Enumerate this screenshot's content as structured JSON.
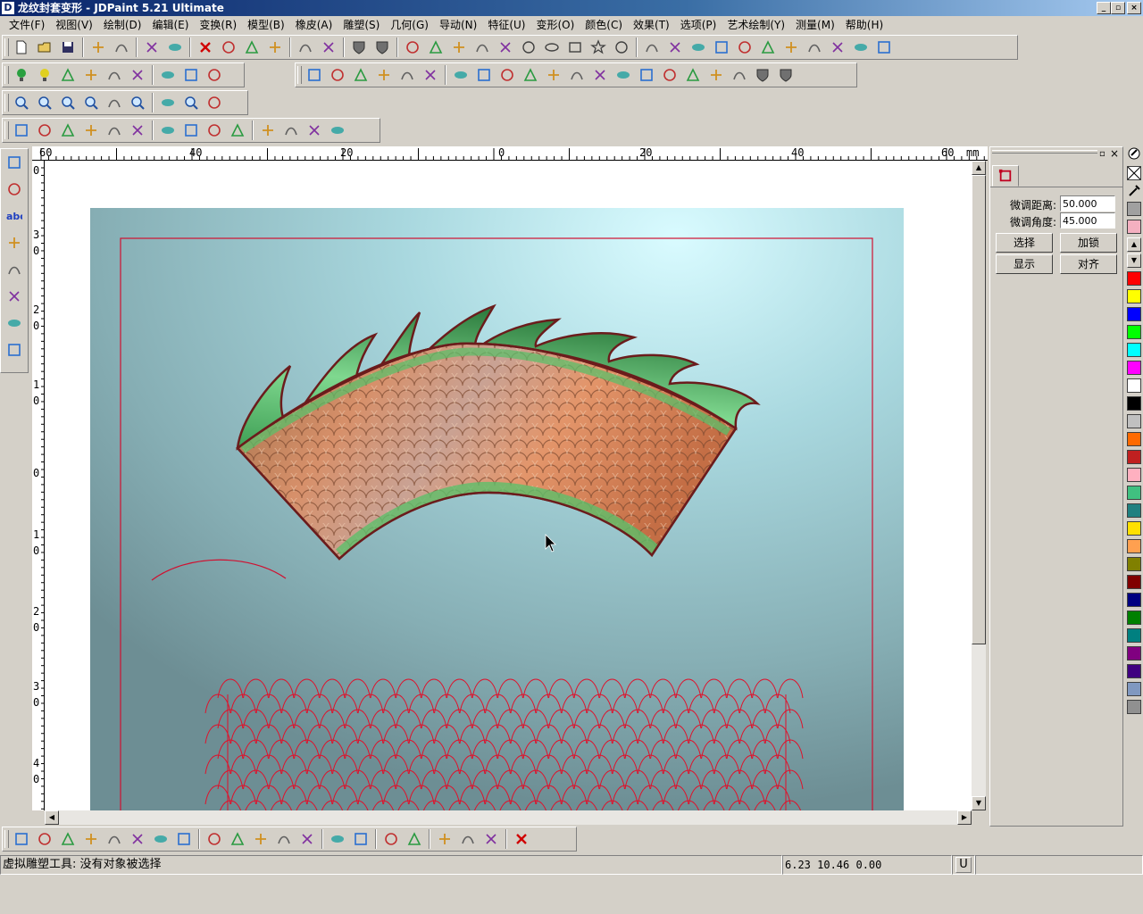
{
  "window": {
    "app_icon": "D",
    "title": "龙纹封套变形 - JDPaint 5.21 Ultimate",
    "controls": [
      "_",
      "▫",
      "×"
    ]
  },
  "menu": [
    "文件(F)",
    "视图(V)",
    "绘制(D)",
    "编辑(E)",
    "变换(R)",
    "模型(B)",
    "橡皮(A)",
    "雕塑(S)",
    "几何(G)",
    "导动(N)",
    "特征(U)",
    "变形(O)",
    "颜色(C)",
    "效果(T)",
    "选项(P)",
    "艺术绘制(Y)",
    "测量(M)",
    "帮助(H)"
  ],
  "ruler": {
    "unit": "mm",
    "top_labels": [
      "60",
      "40",
      "20",
      "0",
      "20",
      "40",
      "60"
    ],
    "left_labels": [
      "0",
      "3\n0",
      "2\n0",
      "1\n0",
      "0",
      "1\n0",
      "2\n0",
      "3\n0",
      "4\n0"
    ]
  },
  "panel": {
    "fine_distance_label": "微调距离:",
    "fine_distance_value": "50.000",
    "fine_angle_label": "微调角度:",
    "fine_angle_value": "45.000",
    "buttons": {
      "select": "选择",
      "lock": "加锁",
      "show": "显示",
      "align": "对齐"
    }
  },
  "palette": [
    "#ff0000",
    "#ffff00",
    "#0000ff",
    "#00ff00",
    "#00ffff",
    "#ff00ff",
    "#ffffff",
    "#000000",
    "#c0c0c0",
    "#ff6a00",
    "#c02020",
    "#ffb0c0",
    "#40c080",
    "#208080",
    "#ffe000",
    "#ffa050",
    "#808000",
    "#800000",
    "#000080",
    "#008000",
    "#008080",
    "#800080",
    "#400080",
    "#8098c0",
    "#909090"
  ],
  "status": {
    "message": "虚拟雕塑工具: 没有对象被选择",
    "coords": "6.23 10.46 0.00",
    "mode": "U"
  },
  "icons": {
    "toolbar_row1": [
      "new-file-icon",
      "open-folder-icon",
      "save-icon",
      "crosshair-icon",
      "select-box-icon",
      "undo-icon",
      "redo-icon",
      "delete-icon",
      "cut-icon",
      "copy-icon",
      "paste-icon",
      "cube-view-icon",
      "box-view-icon",
      "shield-icon",
      "shield-dark-icon",
      "point-icon",
      "line-icon",
      "arc-icon",
      "curve-icon",
      "polygon-icon",
      "circle-icon",
      "ellipse-icon",
      "rectangle-icon",
      "star-icon",
      "ring-icon",
      "trim-icon",
      "extend-icon",
      "fillet-icon",
      "chamfer-icon",
      "corner-icon",
      "offset-icon",
      "slot-icon",
      "frame-icon",
      "group-icon",
      "ungroup-icon",
      "combine-icon"
    ],
    "toolbar_row2": [
      "light-bulb-green-icon",
      "light-bulb-yellow-icon",
      "brush-icon",
      "nodes-icon",
      "diamond-icon",
      "arrow-icon",
      "book-icon",
      "grid-icon",
      "flask-icon",
      "plus-icon",
      "dimension-icon",
      "corner-arrow-icon",
      "box-corner-icon",
      "angle-icon",
      "rotate-icon",
      "align-left-icon",
      "align-center-icon",
      "distribute-icon",
      "align-top-icon",
      "align-middle-icon",
      "array-icon",
      "mesh-icon",
      "wave-icon",
      "spiral-icon",
      "matrix-icon",
      "cross-matrix-icon",
      "layers-icon",
      "stack-icon",
      "cup-icon",
      "cup-dark-icon"
    ],
    "toolbar_row3": [
      "zoom-window-icon",
      "zoom-in-icon",
      "zoom-out-icon",
      "zoom-pan-icon",
      "eye-icon",
      "zoom-fit-icon",
      "move-icon",
      "magnify-icon",
      "refresh-icon"
    ],
    "toolbar_row4": [
      "sculpt-blue-icon",
      "sculpt-wave-icon",
      "eraser-icon",
      "bowl-icon",
      "person-icon",
      "relief-icon",
      "brain-icon",
      "diamond-orange-icon",
      "globe-icon",
      "disk-icon",
      "lift-icon",
      "lift2-icon",
      "lift3-icon",
      "hammer-icon"
    ],
    "left_tools": [
      "select-node-icon",
      "pointer-icon",
      "text-icon",
      "shape-icon",
      "paint-bucket-icon",
      "pen-icon",
      "fill-icon",
      "measure-icon"
    ],
    "bottom_tools": [
      "snap-line-icon",
      "snap-point-icon",
      "snap-arc-icon",
      "snap-cross-icon",
      "snap-corner-icon",
      "snap-circle-icon",
      "snap-perp-icon",
      "snap-tangent-icon",
      "snap-center-icon",
      "snap-mid-icon",
      "diamond-a-icon",
      "diamond-b-icon",
      "diamond-c-icon",
      "layer-up-icon",
      "layer-down-icon",
      "cursor-x-icon",
      "cursor-red-icon",
      "split-icon",
      "join-icon",
      "frame-select-icon",
      "cancel-icon"
    ]
  }
}
